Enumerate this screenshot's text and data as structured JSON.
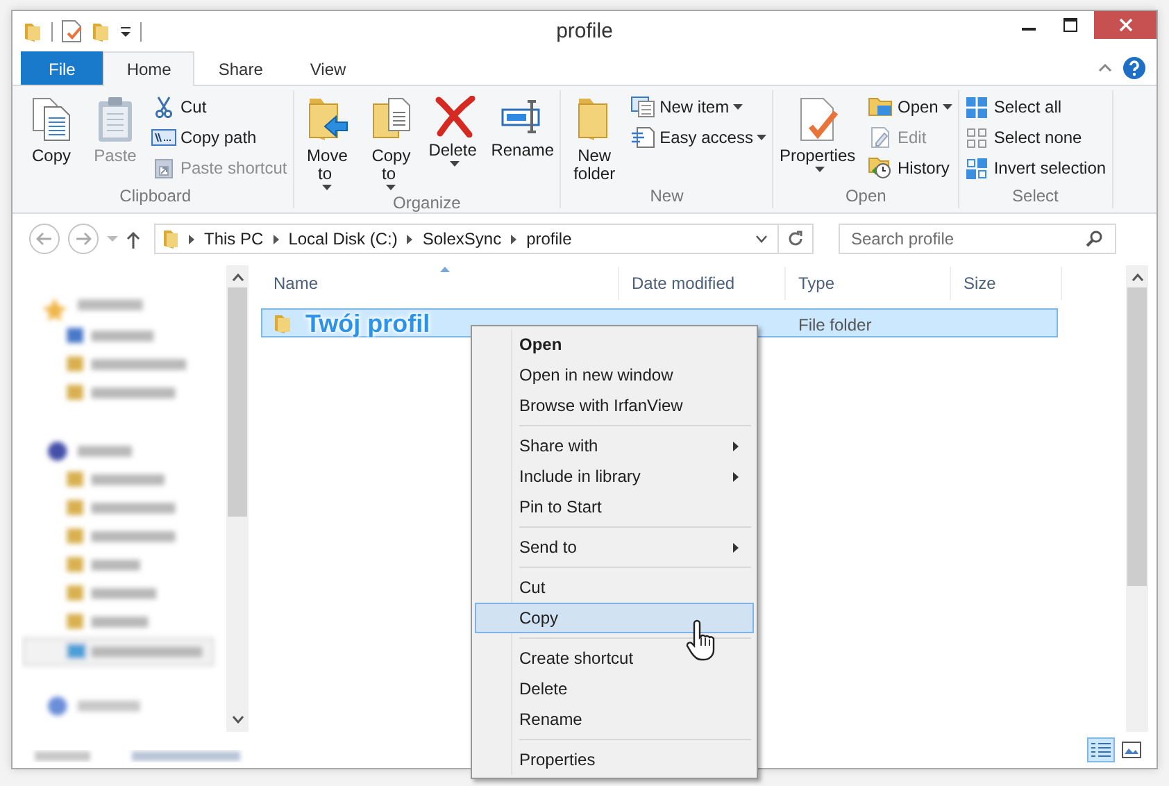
{
  "window": {
    "title": "profile"
  },
  "tabs": [
    {
      "label": "File",
      "kind": "file",
      "selected": false
    },
    {
      "label": "Home",
      "kind": "tab",
      "selected": true
    },
    {
      "label": "Share",
      "kind": "tab",
      "selected": false
    },
    {
      "label": "View",
      "kind": "tab",
      "selected": false
    }
  ],
  "ribbon": {
    "groups": [
      {
        "label": "Clipboard",
        "items": [
          {
            "label": "Copy",
            "kind": "large",
            "disabled": false,
            "dropdown": false
          },
          {
            "label": "Paste",
            "kind": "large",
            "disabled": true,
            "dropdown": false
          },
          {
            "label": "Cut",
            "kind": "small",
            "disabled": false,
            "dropdown": false
          },
          {
            "label": "Copy path",
            "kind": "small",
            "disabled": false,
            "dropdown": false
          },
          {
            "label": "Paste shortcut",
            "kind": "small",
            "disabled": true,
            "dropdown": false
          }
        ]
      },
      {
        "label": "Organize",
        "items": [
          {
            "label": "Move to",
            "kind": "large",
            "disabled": false,
            "dropdown": true
          },
          {
            "label": "Copy to",
            "kind": "large",
            "disabled": false,
            "dropdown": true
          },
          {
            "label": "Delete",
            "kind": "large",
            "disabled": false,
            "dropdown": true
          },
          {
            "label": "Rename",
            "kind": "large",
            "disabled": false,
            "dropdown": false
          }
        ]
      },
      {
        "label": "New",
        "items": [
          {
            "label": "New folder",
            "kind": "large",
            "disabled": false,
            "dropdown": false
          },
          {
            "label": "New item",
            "kind": "small",
            "disabled": false,
            "dropdown": true
          },
          {
            "label": "Easy access",
            "kind": "small",
            "disabled": false,
            "dropdown": true
          }
        ]
      },
      {
        "label": "Open",
        "items": [
          {
            "label": "Properties",
            "kind": "large",
            "disabled": false,
            "dropdown": true
          },
          {
            "label": "Open",
            "kind": "small",
            "disabled": false,
            "dropdown": true
          },
          {
            "label": "Edit",
            "kind": "small",
            "disabled": true,
            "dropdown": false
          },
          {
            "label": "History",
            "kind": "small",
            "disabled": false,
            "dropdown": false
          }
        ]
      },
      {
        "label": "Select",
        "items": [
          {
            "label": "Select all",
            "kind": "small",
            "disabled": false,
            "dropdown": false
          },
          {
            "label": "Select none",
            "kind": "small",
            "disabled": false,
            "dropdown": false
          },
          {
            "label": "Invert selection",
            "kind": "small",
            "disabled": false,
            "dropdown": false
          }
        ]
      }
    ]
  },
  "address": {
    "crumbs": [
      "This PC",
      "Local Disk (C:)",
      "SolexSync",
      "profile"
    ]
  },
  "search": {
    "placeholder": "Search profile"
  },
  "table": {
    "columns": [
      {
        "label": "Name",
        "sorted": true
      },
      {
        "label": "Date modified",
        "sorted": false
      },
      {
        "label": "Type",
        "sorted": false
      },
      {
        "label": "Size",
        "sorted": false
      }
    ],
    "rows": [
      {
        "name": "Twój profil",
        "type": "File folder",
        "selected": true
      }
    ]
  },
  "context_menu": {
    "sections": [
      [
        {
          "label": "Open",
          "bold": true,
          "submenu": false,
          "selected": false
        },
        {
          "label": "Open in new window",
          "bold": false,
          "submenu": false,
          "selected": false
        },
        {
          "label": "Browse with IrfanView",
          "bold": false,
          "submenu": false,
          "selected": false
        }
      ],
      [
        {
          "label": "Share with",
          "bold": false,
          "submenu": true,
          "selected": false
        },
        {
          "label": "Include in library",
          "bold": false,
          "submenu": true,
          "selected": false
        },
        {
          "label": "Pin to Start",
          "bold": false,
          "submenu": false,
          "selected": false
        }
      ],
      [
        {
          "label": "Send to",
          "bold": false,
          "submenu": true,
          "selected": false
        }
      ],
      [
        {
          "label": "Cut",
          "bold": false,
          "submenu": false,
          "selected": false
        },
        {
          "label": "Copy",
          "bold": false,
          "submenu": false,
          "selected": true
        }
      ],
      [
        {
          "label": "Create shortcut",
          "bold": false,
          "submenu": false,
          "selected": false
        },
        {
          "label": "Delete",
          "bold": false,
          "submenu": false,
          "selected": false
        },
        {
          "label": "Rename",
          "bold": false,
          "submenu": false,
          "selected": false
        }
      ],
      [
        {
          "label": "Properties",
          "bold": false,
          "submenu": false,
          "selected": false
        }
      ]
    ]
  },
  "views": [
    {
      "kind": "details",
      "selected": true
    },
    {
      "kind": "large-icons",
      "selected": false
    }
  ]
}
